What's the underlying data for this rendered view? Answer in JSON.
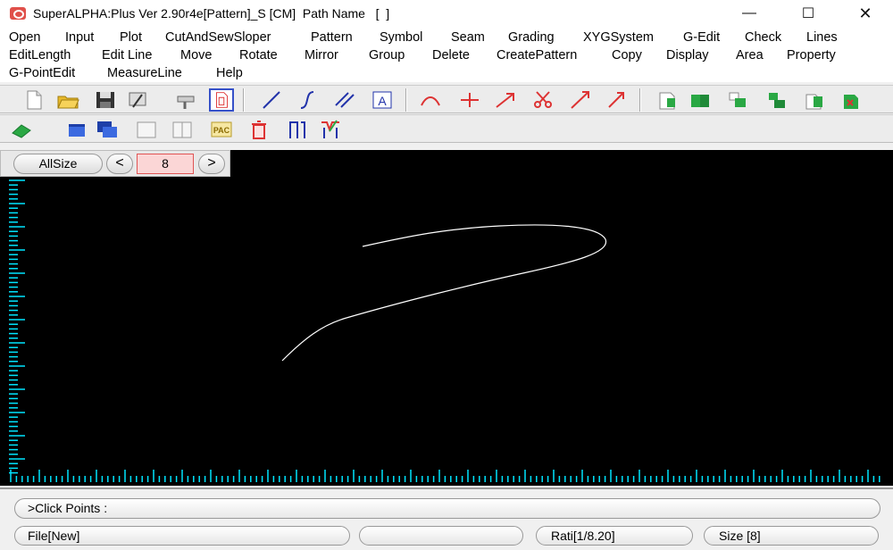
{
  "window": {
    "title": "SuperALPHA:Plus Ver 2.90r4e[Pattern]_S [CM]  Path Name   [  ]",
    "minimize": "—",
    "maximize": "☐",
    "close": "✕"
  },
  "menu": [
    "Open",
    "Input",
    "Plot",
    "CutAndSewSloper",
    "Pattern",
    "Symbol",
    "Seam",
    "Grading",
    "XYGSystem",
    "G-Edit",
    "Check",
    "Lines",
    "EditLength",
    "Edit Line",
    "Move",
    "Rotate",
    "Mirror",
    "Group",
    "Delete",
    "CreatePattern",
    "Copy",
    "Display",
    "Area",
    "Property",
    "G-PointEdit",
    "MeasureLine",
    "Help"
  ],
  "toolbar1": {
    "text_tool_label": "A"
  },
  "toolbar2": {
    "pac_label": "PAC"
  },
  "size_bar": {
    "allsize_label": "AllSize",
    "prev_label": "<",
    "next_label": ">",
    "current_size": "8"
  },
  "command": {
    "prompt": ">Click Points :"
  },
  "status": {
    "file": "File[New]",
    "empty": "",
    "ratio": "Rati[1/8.20]",
    "size": "Size [8]"
  },
  "colors": {
    "canvas_bg": "#000000",
    "ruler": "#00e5ff",
    "curve": "#ffffff"
  }
}
